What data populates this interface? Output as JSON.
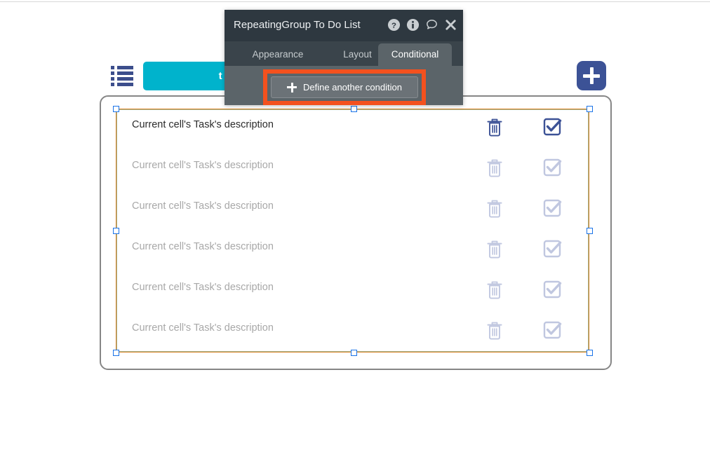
{
  "app": {
    "header": {
      "list_icon": "list-icon",
      "todo_label": "to do",
      "add_icon": "plus-icon"
    },
    "repeating_group": {
      "rows": [
        {
          "description": "Current cell's Task's description",
          "active": true,
          "trash_icon": "trash-icon",
          "check_icon": "checkbox-checked-icon"
        },
        {
          "description": "Current cell's Task's description",
          "active": false,
          "trash_icon": "trash-icon",
          "check_icon": "checkbox-checked-icon"
        },
        {
          "description": "Current cell's Task's description",
          "active": false,
          "trash_icon": "trash-icon",
          "check_icon": "checkbox-checked-icon"
        },
        {
          "description": "Current cell's Task's description",
          "active": false,
          "trash_icon": "trash-icon",
          "check_icon": "checkbox-checked-icon"
        },
        {
          "description": "Current cell's Task's description",
          "active": false,
          "trash_icon": "trash-icon",
          "check_icon": "checkbox-checked-icon"
        },
        {
          "description": "Current cell's Task's description",
          "active": false,
          "trash_icon": "trash-icon",
          "check_icon": "checkbox-checked-icon"
        }
      ]
    }
  },
  "popup": {
    "title": "RepeatingGroup To Do List",
    "title_icons": [
      {
        "name": "help-icon",
        "glyph": "?"
      },
      {
        "name": "info-icon",
        "glyph": "i"
      },
      {
        "name": "comment-icon",
        "glyph": "speech-bubble"
      },
      {
        "name": "close-icon",
        "glyph": "×"
      }
    ],
    "tabs": [
      {
        "label": "Appearance",
        "active": false
      },
      {
        "label": "Layout",
        "active": false
      },
      {
        "label": "Conditional",
        "active": true
      }
    ],
    "define_condition_label": "Define another condition",
    "define_condition_icon": "plus-icon"
  },
  "colors": {
    "accent_cyan": "#00b3cc",
    "navy": "#3c5296",
    "highlight_orange": "#f4511e",
    "selection_blue": "#1a73e8",
    "selection_orange": "#d98324",
    "panel_title_bg": "#2e3840",
    "panel_tab_bg": "#3a444b",
    "panel_body_bg": "#5b6469"
  }
}
